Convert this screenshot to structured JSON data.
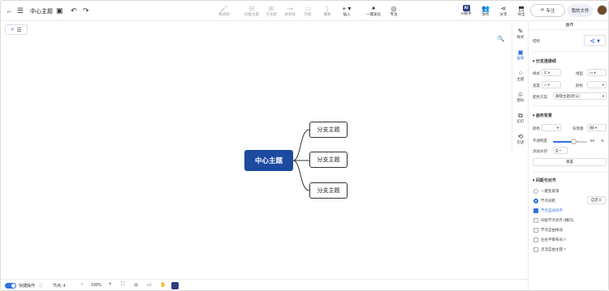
{
  "topbar": {
    "file_title": "中心主题",
    "tools": [
      {
        "label": "格式刷",
        "icon": "format-brush-icon"
      },
      {
        "label": "同级主题",
        "icon": "sibling-topic-icon"
      },
      {
        "label": "子主题",
        "icon": "child-topic-icon"
      },
      {
        "label": "关系线",
        "icon": "relation-line-icon"
      },
      {
        "label": "外框",
        "icon": "boundary-icon"
      },
      {
        "label": "概要",
        "icon": "summary-icon"
      },
      {
        "label": "插入",
        "icon": "insert-plus-icon"
      },
      {
        "label": "一键美化",
        "icon": "magic-wand-icon"
      },
      {
        "label": "专注",
        "icon": "focus-icon"
      }
    ],
    "right_tools": [
      {
        "label": "AI助手",
        "badge": "AI"
      },
      {
        "label": "协作",
        "icon": "collaborate-icon"
      },
      {
        "label": "分享",
        "icon": "share-icon"
      },
      {
        "label": "导出",
        "icon": "export-icon"
      }
    ],
    "save_label": "专注",
    "save_button": "专注",
    "files_button": "我的文件",
    "sync_button": "专注"
  },
  "header_buttons": {
    "save": "专注",
    "myfiles": "我的文件"
  },
  "topbar_save": "专注",
  "canvas": {
    "center_topic": "中心主题",
    "branches": [
      "分支主题",
      "分支主题",
      "分支主题"
    ],
    "line_color": "#333333",
    "center_color": "#1d4aa0"
  },
  "side_tabs": [
    {
      "label": "样式",
      "icon": "style-icon"
    },
    {
      "label": "画布",
      "icon": "canvas-icon",
      "active": true
    },
    {
      "label": "主题",
      "icon": "theme-icon"
    },
    {
      "label": "图标",
      "icon": "emoji-icon"
    },
    {
      "label": "幻灯",
      "icon": "slides-icon"
    },
    {
      "label": "历史",
      "icon": "history-icon"
    }
  ],
  "panel": {
    "header": "画布",
    "structure_label": "结构",
    "branch_line_section": "分支连接线",
    "style_label": "样式",
    "line_end_label": "线型",
    "width_label": "宽度",
    "color_label": "颜色",
    "color_scheme_label": "配色方案",
    "color_scheme_value": "跟随主题(默认)",
    "canvas_bg_section": "画布背景",
    "bg_color_label": "颜色",
    "bg_image_label": "背景图",
    "opacity_label": "不透明度",
    "opacity_value": "60",
    "opacity_unit": "%",
    "opacity_fraction": 0.6,
    "watermark_label": "添加水印",
    "reset_button": "重置",
    "layout_section": "间距与对齐",
    "radio_one_click": "一键变紧凑",
    "radio_node_spacing": "节点间距",
    "custom_button": "自定义",
    "checkboxes": [
      {
        "label": "节点自动对齐",
        "checked": true
      },
      {
        "label": "同级节点对齐 (横向)",
        "checked": false
      },
      {
        "label": "节点自由拖动",
        "checked": false
      },
      {
        "label": "左右平衡布局",
        "checked": false,
        "help": true
      },
      {
        "label": "灵活自由主题",
        "checked": false,
        "help": true
      }
    ]
  },
  "bottombar": {
    "quick_mode_label": "快捷操作",
    "node_count_label": "节点: 4",
    "zoom": "100%"
  }
}
